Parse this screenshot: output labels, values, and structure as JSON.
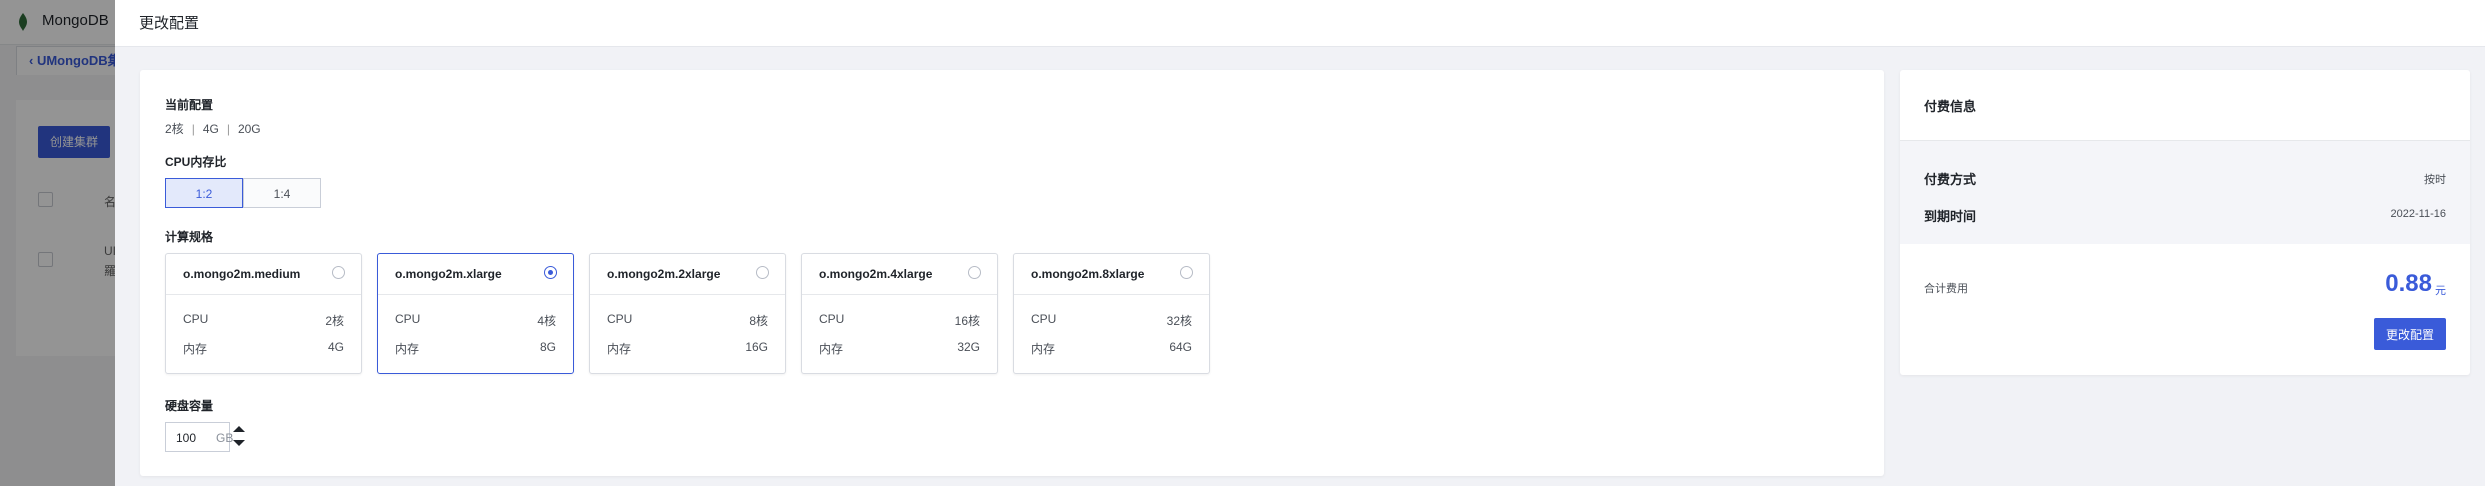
{
  "background_app": {
    "app_name": "MongoDB",
    "breadcrumb": "‹ UMongoDB集",
    "create_button": "创建集群",
    "col_partial": "名",
    "row_partial_1": "UI",
    "row_partial_2": "羅"
  },
  "drawer": {
    "title": "更改配置"
  },
  "current_config": {
    "label": "当前配置",
    "cpu": "2核",
    "memory": "4G",
    "disk": "20G",
    "separator": "|"
  },
  "cpu_ratio": {
    "label": "CPU内存比",
    "options": [
      "1:2",
      "1:4"
    ],
    "selected": "1:2"
  },
  "compute_spec": {
    "label": "计算规格",
    "cpu_key": "CPU",
    "mem_key": "内存",
    "options": [
      {
        "name": "o.mongo2m.medium",
        "cpu": "2核",
        "memory": "4G",
        "selected": false
      },
      {
        "name": "o.mongo2m.xlarge",
        "cpu": "4核",
        "memory": "8G",
        "selected": true
      },
      {
        "name": "o.mongo2m.2xlarge",
        "cpu": "8核",
        "memory": "16G",
        "selected": false
      },
      {
        "name": "o.mongo2m.4xlarge",
        "cpu": "16核",
        "memory": "32G",
        "selected": false
      },
      {
        "name": "o.mongo2m.8xlarge",
        "cpu": "32核",
        "memory": "64G",
        "selected": false
      }
    ]
  },
  "disk": {
    "label": "硬盘容量",
    "value": "100",
    "unit": "GB"
  },
  "payment": {
    "title": "付费信息",
    "method_label": "付费方式",
    "method_value": "按时",
    "expire_label": "到期时间",
    "expire_value": "2022-11-16",
    "total_label": "合计费用",
    "total_amount": "0.88",
    "total_unit": "元",
    "submit_label": "更改配置"
  },
  "colors": {
    "accent": "#3a5bd9",
    "mask": "rgba(0,0,0,0.42)"
  }
}
